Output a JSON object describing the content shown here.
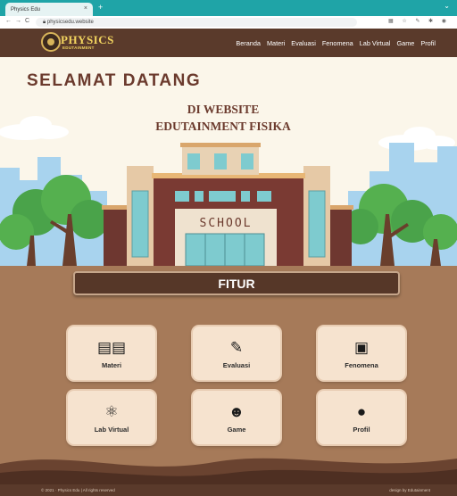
{
  "browser": {
    "tab_title": "Physics Edu",
    "tab_close": "×",
    "new_tab": "+",
    "url": "physicsedu.website",
    "back": "←",
    "forward": "→",
    "reload": "C"
  },
  "nav": {
    "logo_title": "PHYSICS",
    "logo_sub": "EDUTAINMENT",
    "items": [
      "Beranda",
      "Materi",
      "Evaluasi",
      "Fenomena",
      "Lab Virtual",
      "Game",
      "Profil"
    ]
  },
  "hero": {
    "title": "SELAMAT DATANG",
    "subtitle1": "DI WEBSITE",
    "subtitle2": "EDUTAINMENT FISIKA",
    "sign": "SCHOOL"
  },
  "fitur": {
    "title": "FITUR",
    "cards": [
      {
        "label": "Materi",
        "icon": "book-icon"
      },
      {
        "label": "Evaluasi",
        "icon": "pencil-ruler-icon"
      },
      {
        "label": "Fenomena",
        "icon": "images-icon"
      },
      {
        "label": "Lab Virtual",
        "icon": "atom-icon"
      },
      {
        "label": "Game",
        "icon": "game-bot-icon"
      },
      {
        "label": "Profil",
        "icon": "user-icon"
      }
    ]
  },
  "footer": {
    "left": "© 2021 · Physics Edu | All rights reserved",
    "right": "design by Edutainment"
  },
  "colors": {
    "nav": "#5a3a2b",
    "hero_bg": "#fbf6ea",
    "section": "#a67a59",
    "card": "#f6e3cf",
    "title": "#6b3a2d",
    "chrome": "#1fa4a7"
  }
}
